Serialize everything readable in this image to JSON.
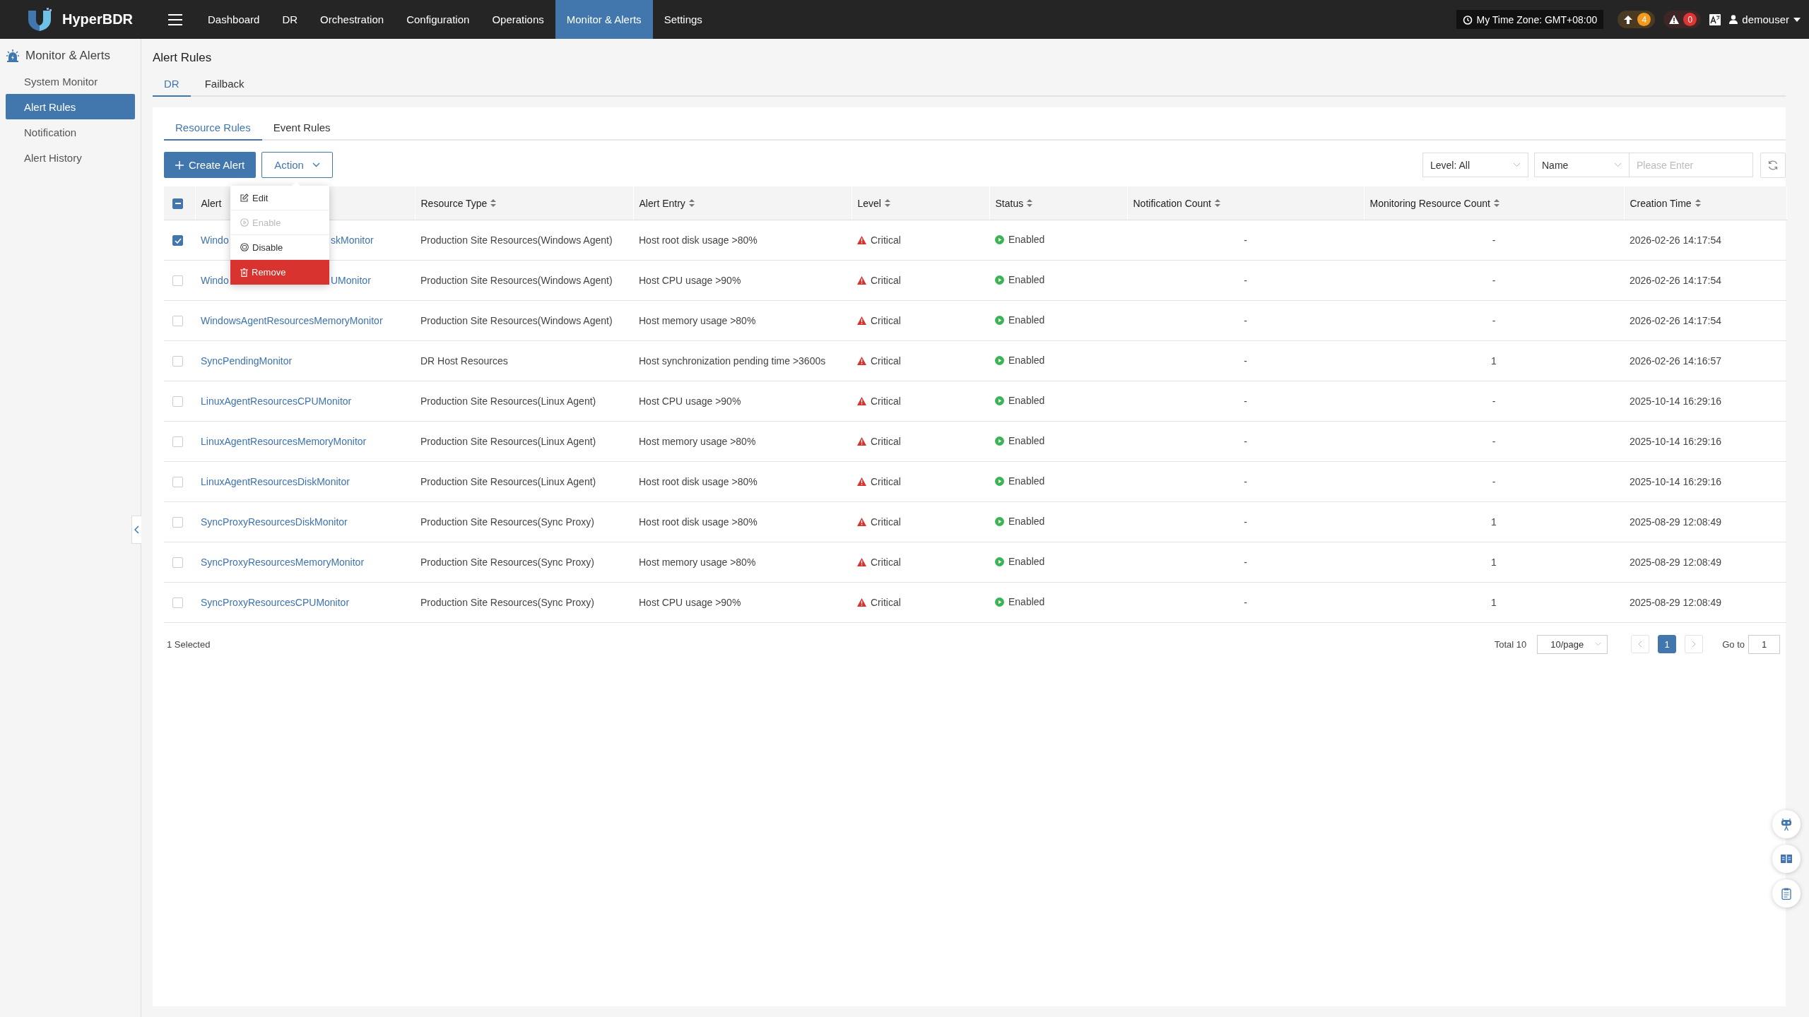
{
  "topbar": {
    "brand": "HyperBDR",
    "nav": [
      {
        "label": "Dashboard",
        "selected": false
      },
      {
        "label": "DR",
        "selected": false
      },
      {
        "label": "Orchestration",
        "selected": false
      },
      {
        "label": "Configuration",
        "selected": false
      },
      {
        "label": "Operations",
        "selected": false
      },
      {
        "label": "Monitor & Alerts",
        "selected": true
      },
      {
        "label": "Settings",
        "selected": false
      }
    ],
    "timezone": "My Time Zone: GMT+08:00",
    "upgrade_count": "4",
    "alert_count": "0",
    "user": "demouser"
  },
  "sidebar": {
    "title": "Monitor & Alerts",
    "items": [
      {
        "label": "System Monitor",
        "selected": false
      },
      {
        "label": "Alert Rules",
        "selected": true
      },
      {
        "label": "Notification",
        "selected": false
      },
      {
        "label": "Alert History",
        "selected": false
      }
    ]
  },
  "page": {
    "title": "Alert Rules",
    "tabs": [
      {
        "label": "DR",
        "selected": true
      },
      {
        "label": "Failback",
        "selected": false
      }
    ],
    "subtabs": [
      {
        "label": "Resource Rules",
        "selected": true
      },
      {
        "label": "Event Rules",
        "selected": false
      }
    ]
  },
  "toolbar": {
    "create_button": "Create Alert",
    "action_button": "Action",
    "level_filter": "Level: All",
    "field_select": "Name",
    "search": {
      "placeholder": "Please Enter"
    }
  },
  "action_menu": {
    "items": [
      {
        "label": "Edit",
        "kind": "edit",
        "disabled": false,
        "highlighted": false
      },
      {
        "label": "Enable",
        "kind": "enable",
        "disabled": true,
        "highlighted": false
      },
      {
        "label": "Disable",
        "kind": "disable",
        "disabled": false,
        "highlighted": false
      },
      {
        "label": "Remove",
        "kind": "remove",
        "disabled": false,
        "highlighted": true
      }
    ]
  },
  "table": {
    "select_all": {
      "indeterminate": true
    },
    "columns": [
      {
        "label": "Alert",
        "sortable": false
      },
      {
        "label": "Resource Type",
        "sortable": true
      },
      {
        "label": "Alert Entry",
        "sortable": true
      },
      {
        "label": "Level",
        "sortable": true
      },
      {
        "label": "Status",
        "sortable": true
      },
      {
        "label": "Notification Count",
        "sortable": true
      },
      {
        "label": "Monitoring Resource Count",
        "sortable": true
      },
      {
        "label": "Creation Time",
        "sortable": true
      }
    ],
    "rows": [
      {
        "selected": true,
        "name_parts": [
          "Windo",
          "skMonitor"
        ],
        "resource_type": "Production Site Resources(Windows Agent)",
        "alert_entry": "Host root disk usage >80%",
        "level": "Critical",
        "status": "Enabled",
        "notification_count": "-",
        "monitoring_count": "-",
        "created": "2026-02-26 14:17:54"
      },
      {
        "selected": false,
        "name_parts": [
          "Windo",
          "UMonitor"
        ],
        "resource_type": "Production Site Resources(Windows Agent)",
        "alert_entry": "Host CPU usage >90%",
        "level": "Critical",
        "status": "Enabled",
        "notification_count": "-",
        "monitoring_count": "-",
        "created": "2026-02-26 14:17:54"
      },
      {
        "selected": false,
        "name": "WindowsAgentResourcesMemoryMonitor",
        "resource_type": "Production Site Resources(Windows Agent)",
        "alert_entry": "Host memory usage >80%",
        "level": "Critical",
        "status": "Enabled",
        "notification_count": "-",
        "monitoring_count": "-",
        "created": "2026-02-26 14:17:54"
      },
      {
        "selected": false,
        "name": "SyncPendingMonitor",
        "resource_type": "DR Host Resources",
        "alert_entry": "Host synchronization pending time >3600s",
        "level": "Critical",
        "status": "Enabled",
        "notification_count": "-",
        "monitoring_count": "1",
        "created": "2026-02-26 14:16:57"
      },
      {
        "selected": false,
        "name": "LinuxAgentResourcesCPUMonitor",
        "resource_type": "Production Site Resources(Linux Agent)",
        "alert_entry": "Host CPU usage >90%",
        "level": "Critical",
        "status": "Enabled",
        "notification_count": "-",
        "monitoring_count": "-",
        "created": "2025-10-14 16:29:16"
      },
      {
        "selected": false,
        "name": "LinuxAgentResourcesMemoryMonitor",
        "resource_type": "Production Site Resources(Linux Agent)",
        "alert_entry": "Host memory usage >80%",
        "level": "Critical",
        "status": "Enabled",
        "notification_count": "-",
        "monitoring_count": "-",
        "created": "2025-10-14 16:29:16"
      },
      {
        "selected": false,
        "name": "LinuxAgentResourcesDiskMonitor",
        "resource_type": "Production Site Resources(Linux Agent)",
        "alert_entry": "Host root disk usage >80%",
        "level": "Critical",
        "status": "Enabled",
        "notification_count": "-",
        "monitoring_count": "-",
        "created": "2025-10-14 16:29:16"
      },
      {
        "selected": false,
        "name": "SyncProxyResourcesDiskMonitor",
        "resource_type": "Production Site Resources(Sync Proxy)",
        "alert_entry": "Host root disk usage >80%",
        "level": "Critical",
        "status": "Enabled",
        "notification_count": "-",
        "monitoring_count": "1",
        "created": "2025-08-29 12:08:49"
      },
      {
        "selected": false,
        "name": "SyncProxyResourcesMemoryMonitor",
        "resource_type": "Production Site Resources(Sync Proxy)",
        "alert_entry": "Host memory usage >80%",
        "level": "Critical",
        "status": "Enabled",
        "notification_count": "-",
        "monitoring_count": "1",
        "created": "2025-08-29 12:08:49"
      },
      {
        "selected": false,
        "name": "SyncProxyResourcesCPUMonitor",
        "resource_type": "Production Site Resources(Sync Proxy)",
        "alert_entry": "Host CPU usage >90%",
        "level": "Critical",
        "status": "Enabled",
        "notification_count": "-",
        "monitoring_count": "1",
        "created": "2025-08-29 12:08:49"
      }
    ]
  },
  "footer": {
    "selected_text": "1 Selected",
    "total": "Total 10",
    "page_size": "10/page",
    "pages": [
      {
        "label": "1",
        "selected": true
      }
    ],
    "goto_label": "Go to",
    "goto_value": "1"
  }
}
